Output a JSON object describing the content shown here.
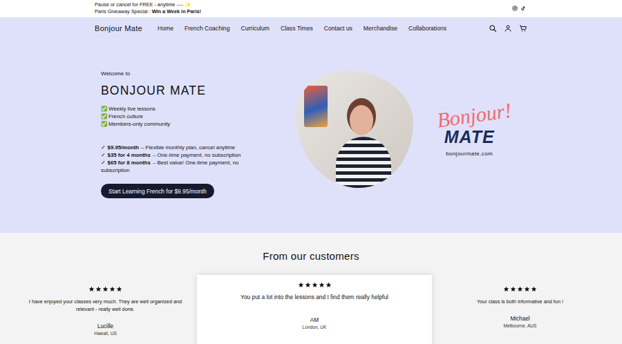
{
  "announcement": {
    "lines": [
      {
        "text": "Pause or cancel for FREE - anytime ---- ✨",
        "strong": ""
      },
      {
        "text": "Paris Giveaway Special : ",
        "strong": "Win a Week in Paris!"
      }
    ]
  },
  "nav": {
    "logo": "Bonjour Mate",
    "items": [
      "Home",
      "French Coaching",
      "Curriculum",
      "Class Times",
      "Contact us",
      "Merchandise",
      "Collaborations"
    ]
  },
  "hero": {
    "eyebrow": "Welcome to",
    "title": "BONJOUR MATE",
    "features": [
      {
        "mark": "✅",
        "text": "Weekly live lessons"
      },
      {
        "mark": "✅",
        "text": "French culture"
      },
      {
        "mark": "✅",
        "text": "Members-only community"
      }
    ],
    "plans": [
      {
        "mark": "✓",
        "price": "$9.95/month",
        "desc": "– Flexible monthly plan, cancel anytime"
      },
      {
        "mark": "✓",
        "price": "$35 for 4 months",
        "desc": "– One-time payment, no subscription"
      },
      {
        "mark": "✓",
        "price": "$65 for 8 months",
        "desc": "– Best value! One-time payment, no subscription"
      }
    ],
    "button": "Start Learning French for $9.95/month"
  },
  "brand": {
    "script": "Bonjour!",
    "word": "MATE",
    "url": "bonjourmate.com"
  },
  "testimonials": {
    "title": "From our customers",
    "items": [
      {
        "stars": 5,
        "text": "I have enjoyed your classes very much. They are well organized and relevant - really well done.",
        "name": "Lucille",
        "location": "Hawaii, US",
        "selected": false
      },
      {
        "stars": 5,
        "text": "You put a lot into the lessons and I find them really helpful",
        "name": "AM",
        "location": "London, UK",
        "selected": true
      },
      {
        "stars": 5,
        "text": "Your class is both informative and fun !",
        "name": "Michael",
        "location": "Melbourne, AUS",
        "selected": false
      }
    ]
  }
}
